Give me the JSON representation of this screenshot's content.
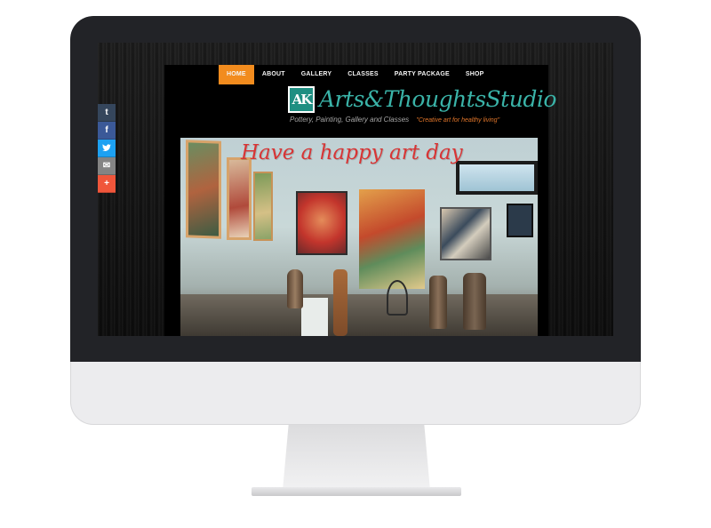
{
  "colors": {
    "nav_active": "#f28c1e",
    "logo_teal": "#3ab3a8",
    "tagline_orange": "#e2762a",
    "headline_red": "#d83434"
  },
  "nav": {
    "items": [
      {
        "label": "HOME",
        "active": true
      },
      {
        "label": "ABOUT",
        "active": false
      },
      {
        "label": "GALLERY",
        "active": false
      },
      {
        "label": "CLASSES",
        "active": false
      },
      {
        "label": "PARTY PACKAGE",
        "active": false
      },
      {
        "label": "SHOP",
        "active": false
      }
    ]
  },
  "logo": {
    "mark": "AK",
    "title": "Arts&ThoughtsStudio"
  },
  "tagline": {
    "main": "Pottery, Painting, Gallery and Classes",
    "quote": "\"Creative art for healthy living\""
  },
  "hero": {
    "headline": "Have a happy art day"
  },
  "share": {
    "buttons": [
      {
        "name": "tumblr-icon",
        "glyph": "t",
        "color": "#35465c"
      },
      {
        "name": "facebook-icon",
        "glyph": "f",
        "color": "#3b5998"
      },
      {
        "name": "twitter-icon",
        "glyph": "🐦",
        "color": "#1da1f2"
      },
      {
        "name": "email-icon",
        "glyph": "✉",
        "color": "#848484"
      },
      {
        "name": "more-icon",
        "glyph": "+",
        "color": "#f0563b"
      }
    ]
  }
}
